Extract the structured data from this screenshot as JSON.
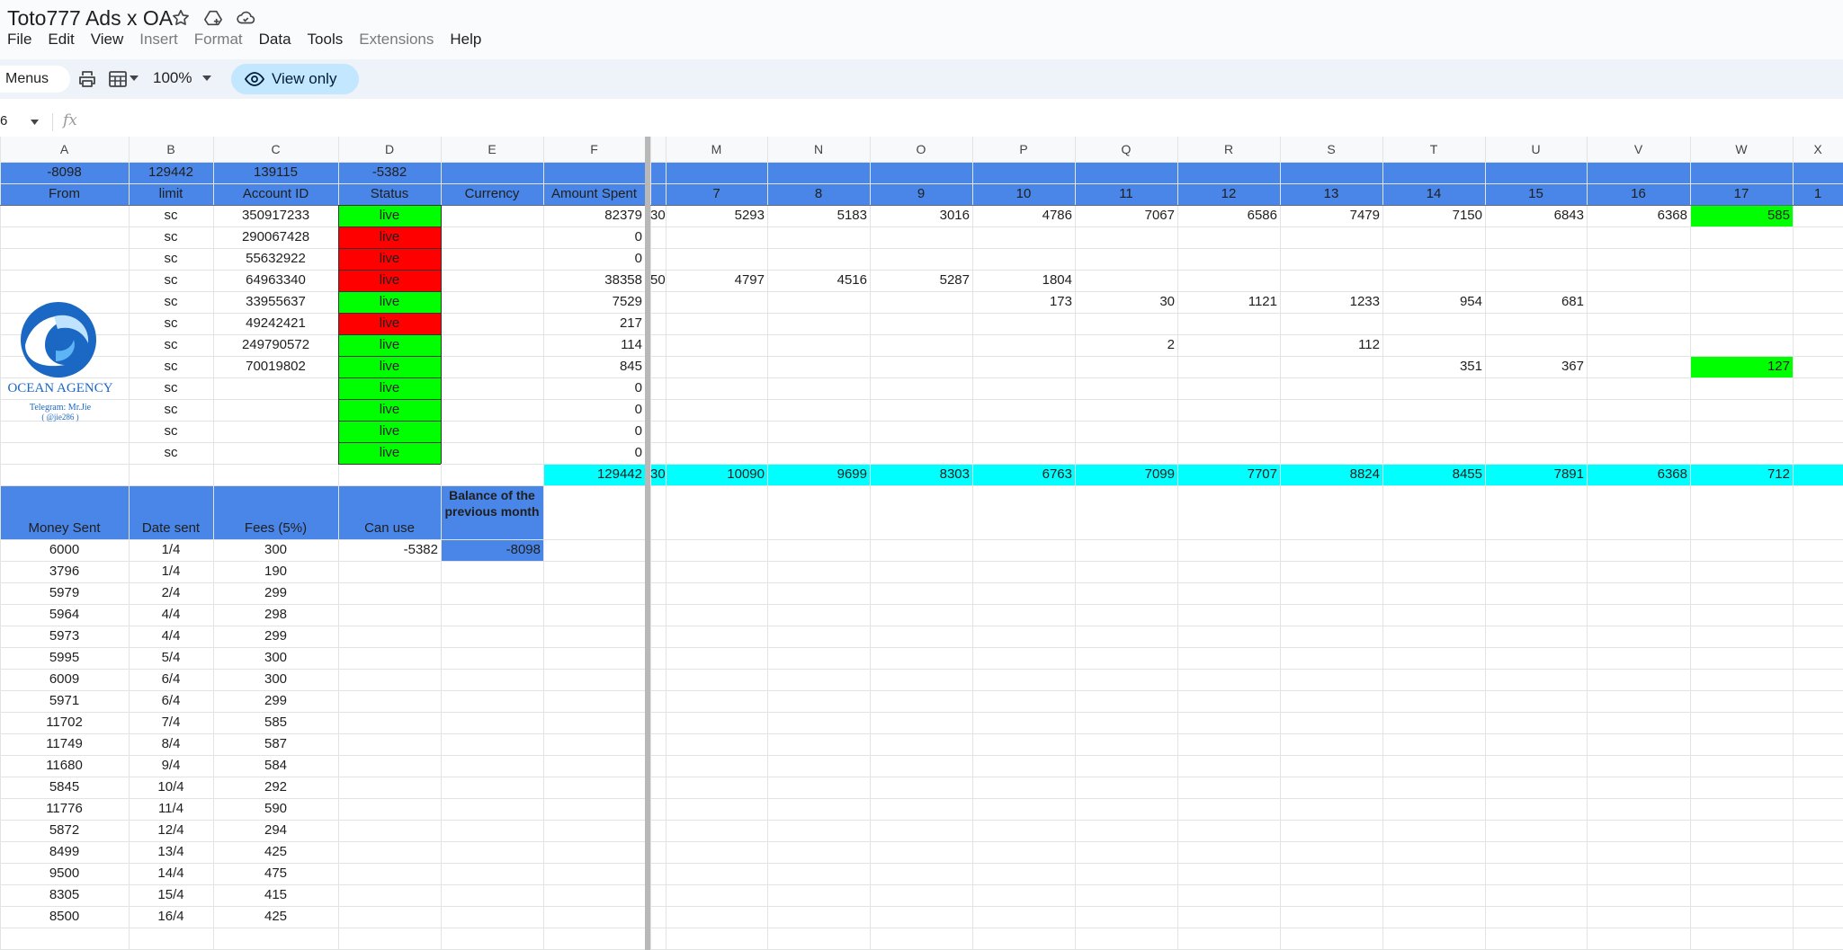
{
  "app": {
    "title": "Toto777 Ads x OA",
    "menus": [
      "File",
      "Edit",
      "View",
      "Insert",
      "Format",
      "Data",
      "Tools",
      "Extensions",
      "Help"
    ],
    "disabled_menus": [
      "Insert",
      "Format",
      "Extensions"
    ]
  },
  "toolbar": {
    "menus_label": "Menus",
    "zoom": "100%",
    "view_only_label": "View only"
  },
  "formula_bar": {
    "name_box": "6",
    "fx": "fx"
  },
  "columns": [
    "A",
    "B",
    "C",
    "D",
    "E",
    "F",
    "M",
    "N",
    "O",
    "P",
    "Q",
    "R",
    "S",
    "T",
    "U",
    "V",
    "W",
    "X"
  ],
  "colors": {
    "header_blue": "#4a86e8",
    "live_green": "#00ff00",
    "dead_red": "#ff0000",
    "total_cyan": "#00ffff",
    "gridline": "#e2e3e3",
    "header_bg": "#f8f9fa"
  },
  "summary_row": [
    "-8098",
    "129442",
    "139115",
    "-5382"
  ],
  "header_row": [
    "From",
    "limit",
    "Account ID",
    "Status",
    "Currency",
    "Amount Spent"
  ],
  "day_headers": [
    "7",
    "8",
    "9",
    "10",
    "11",
    "12",
    "13",
    "14",
    "15",
    "16",
    "17",
    "1"
  ],
  "accounts": [
    {
      "limit": "sc",
      "id": "350917233",
      "status": "live",
      "status_color": "green",
      "spent": "82379",
      "partial": "30",
      "days": [
        "5293",
        "5183",
        "3016",
        "4786",
        "7067",
        "6586",
        "7479",
        "7150",
        "6843",
        "6368",
        "585"
      ]
    },
    {
      "limit": "sc",
      "id": "290067428",
      "status": "live",
      "status_color": "red",
      "spent": "0",
      "partial": "",
      "days": [
        "",
        "",
        "",
        "",
        "",
        "",
        "",
        "",
        "",
        "",
        ""
      ]
    },
    {
      "limit": "sc",
      "id": "55632922",
      "status": "live",
      "status_color": "red",
      "spent": "0",
      "partial": "",
      "days": [
        "",
        "",
        "",
        "",
        "",
        "",
        "",
        "",
        "",
        "",
        ""
      ]
    },
    {
      "limit": "sc",
      "id": "64963340",
      "status": "live",
      "status_color": "red",
      "spent": "38358",
      "partial": "50",
      "days": [
        "4797",
        "4516",
        "5287",
        "1804",
        "",
        "",
        "",
        "",
        "",
        "",
        ""
      ]
    },
    {
      "limit": "sc",
      "id": "33955637",
      "status": "live",
      "status_color": "green",
      "spent": "7529",
      "partial": "",
      "days": [
        "",
        "",
        "",
        "173",
        "30",
        "1121",
        "1233",
        "954",
        "681",
        "",
        ""
      ]
    },
    {
      "limit": "sc",
      "id": "49242421",
      "status": "live",
      "status_color": "red",
      "spent": "217",
      "partial": "",
      "days": [
        "",
        "",
        "",
        "",
        "",
        "",
        "",
        "",
        "",
        "",
        ""
      ]
    },
    {
      "limit": "sc",
      "id": "249790572",
      "status": "live",
      "status_color": "green",
      "spent": "114",
      "partial": "",
      "days": [
        "",
        "",
        "",
        "",
        "2",
        "",
        "112",
        "",
        "",
        "",
        ""
      ]
    },
    {
      "limit": "sc",
      "id": "70019802",
      "status": "live",
      "status_color": "green",
      "spent": "845",
      "partial": "",
      "days": [
        "",
        "",
        "",
        "",
        "",
        "",
        "",
        "351",
        "367",
        "",
        "127"
      ]
    },
    {
      "limit": "sc",
      "id": "",
      "status": "live",
      "status_color": "green",
      "spent": "0",
      "partial": "",
      "days": [
        "",
        "",
        "",
        "",
        "",
        "",
        "",
        "",
        "",
        "",
        ""
      ]
    },
    {
      "limit": "sc",
      "id": "",
      "status": "live",
      "status_color": "green",
      "spent": "0",
      "partial": "",
      "days": [
        "",
        "",
        "",
        "",
        "",
        "",
        "",
        "",
        "",
        "",
        ""
      ]
    },
    {
      "limit": "sc",
      "id": "",
      "status": "live",
      "status_color": "green",
      "spent": "0",
      "partial": "",
      "days": [
        "",
        "",
        "",
        "",
        "",
        "",
        "",
        "",
        "",
        "",
        ""
      ]
    },
    {
      "limit": "sc",
      "id": "",
      "status": "live",
      "status_color": "green",
      "spent": "0",
      "partial": "",
      "days": [
        "",
        "",
        "",
        "",
        "",
        "",
        "",
        "",
        "",
        "",
        ""
      ]
    }
  ],
  "totals": {
    "spent": "129442",
    "partial": "30",
    "days": [
      "10090",
      "9699",
      "8303",
      "6763",
      "7099",
      "7707",
      "8824",
      "8455",
      "7891",
      "6368",
      "712"
    ]
  },
  "logo": {
    "name": "OCEAN AGENCY",
    "telegram_line1": "Telegram: Mr.Jie",
    "telegram_line2": "( @jie286 )"
  },
  "payments_header": [
    "Money Sent",
    "Date sent",
    "Fees (5%)",
    "Can use",
    "Balance of the previous month"
  ],
  "can_use": "-5382",
  "balance_prev": "-8098",
  "payments": [
    [
      "6000",
      "1/4",
      "300"
    ],
    [
      "3796",
      "1/4",
      "190"
    ],
    [
      "5979",
      "2/4",
      "299"
    ],
    [
      "5964",
      "4/4",
      "298"
    ],
    [
      "5973",
      "4/4",
      "299"
    ],
    [
      "5995",
      "5/4",
      "300"
    ],
    [
      "6009",
      "6/4",
      "300"
    ],
    [
      "5971",
      "6/4",
      "299"
    ],
    [
      "11702",
      "7/4",
      "585"
    ],
    [
      "11749",
      "8/4",
      "587"
    ],
    [
      "11680",
      "9/4",
      "584"
    ],
    [
      "5845",
      "10/4",
      "292"
    ],
    [
      "11776",
      "11/4",
      "590"
    ],
    [
      "5872",
      "12/4",
      "294"
    ],
    [
      "8499",
      "13/4",
      "425"
    ],
    [
      "9500",
      "14/4",
      "475"
    ],
    [
      "8305",
      "15/4",
      "415"
    ],
    [
      "8500",
      "16/4",
      "425"
    ]
  ]
}
